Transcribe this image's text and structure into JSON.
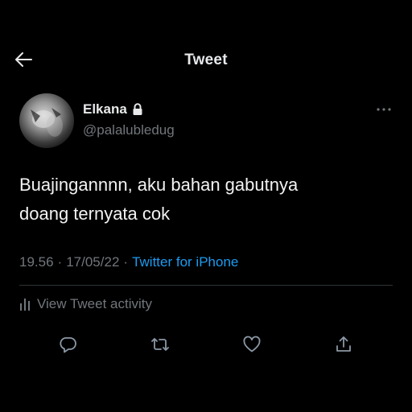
{
  "header": {
    "title": "Tweet",
    "back_icon": "arrow-left-icon"
  },
  "author": {
    "name": "Elkana",
    "handle": "@palalubledug",
    "protected_icon": "lock-icon",
    "more_icon": "more-horizontal-icon"
  },
  "tweet": {
    "text": "Buajingannnn, aku bahan gabutnya\ndoang ternyata cok",
    "time": "19.56",
    "separator": "·",
    "date": "17/05/22",
    "source": "Twitter for iPhone"
  },
  "activity": {
    "label": "View Tweet activity",
    "icon": "bar-chart-icon"
  },
  "actions": {
    "reply_icon": "reply-icon",
    "retweet_icon": "retweet-icon",
    "like_icon": "heart-icon",
    "share_icon": "share-icon"
  },
  "colors": {
    "background": "#000000",
    "primary_text": "#e7e9ea",
    "secondary_text": "#71767b",
    "accent": "#1d9bf0",
    "divider": "#2f3336"
  }
}
